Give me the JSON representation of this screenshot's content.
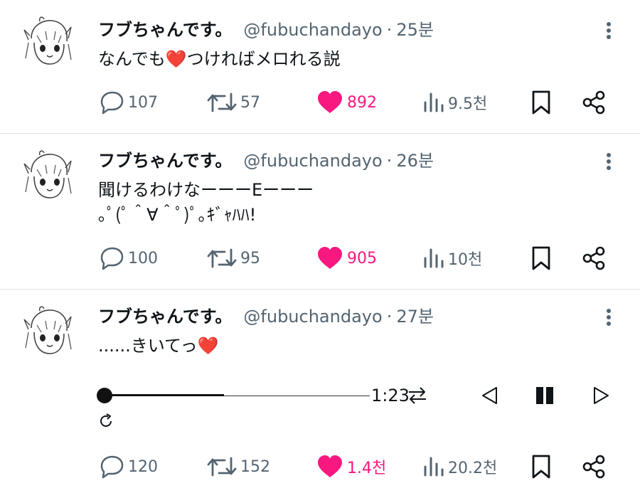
{
  "colors": {
    "like": "#f91880",
    "muted": "#536471",
    "text": "#0f1419",
    "divider": "#dfe3e6"
  },
  "tweets": [
    {
      "author": "フブちゃんです。",
      "handle": "@fubuchandayo",
      "separator": "·",
      "time": "25분",
      "lines": [
        "なんでも❤️つければメロれる説"
      ],
      "stats": {
        "replies": "107",
        "retweets": "57",
        "likes": "892",
        "views": "9.5천"
      }
    },
    {
      "author": "フブちゃんです。",
      "handle": "@fubuchandayo",
      "separator": "·",
      "time": "26분",
      "lines": [
        "聞けるわけなーーーEーーー",
        "｡ﾟ(ﾟ＾∀＾ﾟ)ﾟ｡ｷﾞｬﾊﾊ!"
      ],
      "stats": {
        "replies": "100",
        "retweets": "95",
        "likes": "905",
        "views": "10천"
      }
    },
    {
      "author": "フブちゃんです。",
      "handle": "@fubuchandayo",
      "separator": "·",
      "time": "27분",
      "lines": [
        "......きいてっ❤️"
      ],
      "audio": {
        "elapsed": "1:23",
        "progress": 0.45
      },
      "stats": {
        "replies": "120",
        "retweets": "152",
        "likes": "1.4천",
        "views": "20.2천"
      }
    }
  ],
  "icons": {
    "avatar": "avatar-sketch-icon",
    "more": "more-vertical-icon",
    "reply": "reply-icon",
    "retweet": "retweet-icon",
    "like": "heart-filled-icon",
    "views": "views-chart-icon",
    "bookmark": "bookmark-icon",
    "share": "share-icon",
    "loop": "swap-arrows-icon",
    "prev": "previous-icon",
    "pause": "pause-icon",
    "next": "next-icon",
    "repeat": "repeat-icon"
  }
}
